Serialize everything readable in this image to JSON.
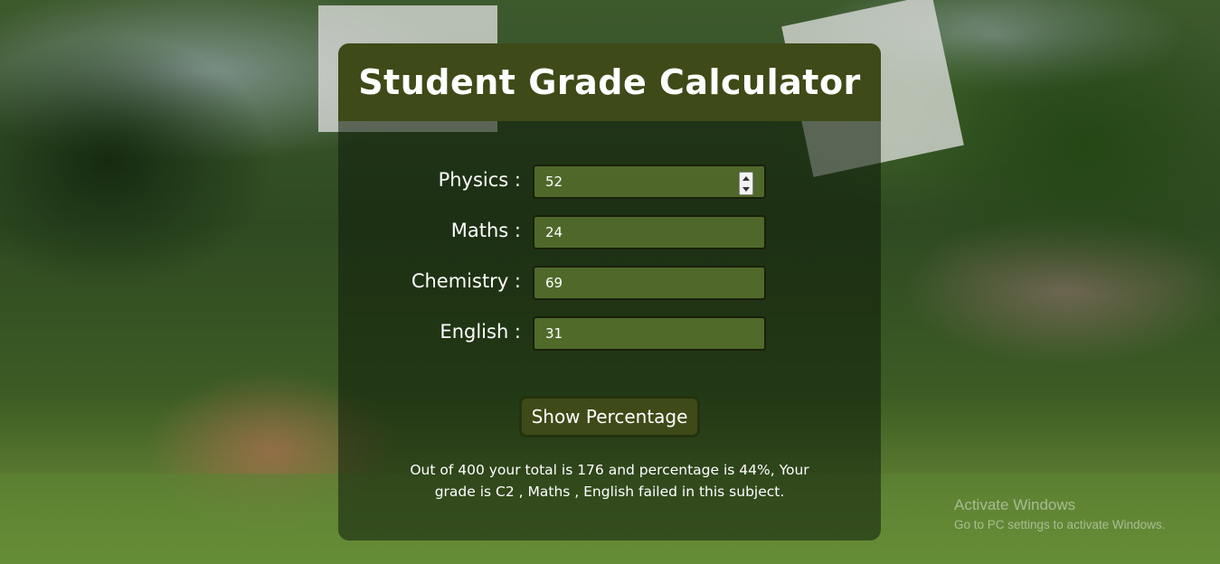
{
  "app": {
    "title": "Student Grade Calculator"
  },
  "form": {
    "fields": [
      {
        "label": "Physics :",
        "value": "52"
      },
      {
        "label": "Maths :",
        "value": "24"
      },
      {
        "label": "Chemistry :",
        "value": "69"
      },
      {
        "label": "English :",
        "value": "31"
      }
    ],
    "button_label": "Show Percentage"
  },
  "result": {
    "line1": "Out of 400 your total is 176 and percentage is 44%, Your",
    "line2": "grade is C2 , Maths , English failed in this subject."
  },
  "watermark": {
    "title": "Activate Windows",
    "subtitle": "Go to PC settings to activate Windows."
  },
  "colors": {
    "header_bg": "#3e4a18",
    "button_bg": "#3e4a18",
    "text": "#ffffff"
  },
  "icons": {
    "stepper": "number-stepper-icon"
  }
}
